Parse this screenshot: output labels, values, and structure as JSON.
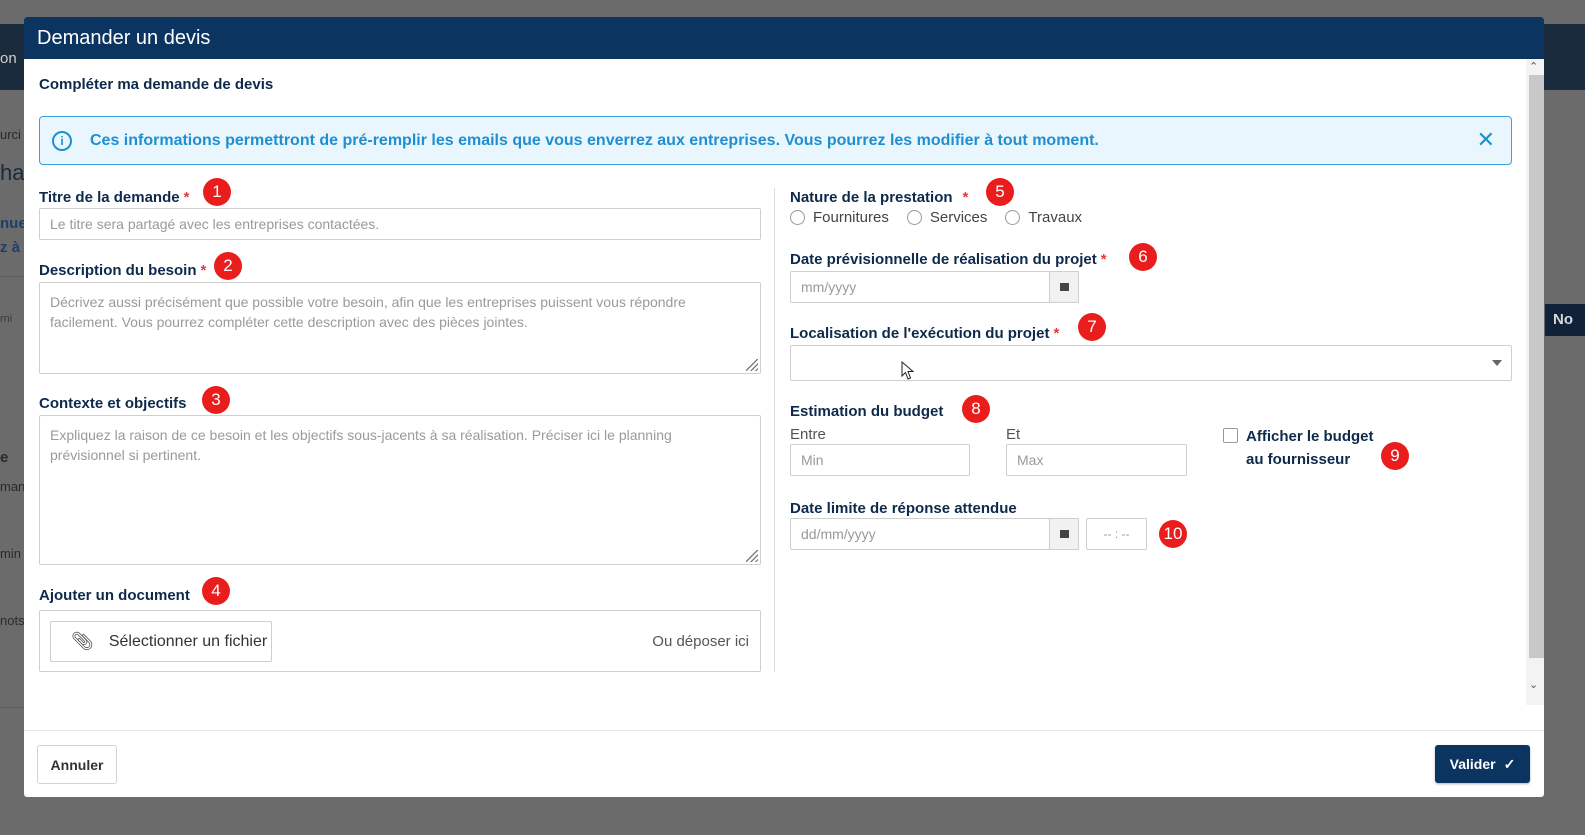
{
  "background": {
    "fragments": [
      "on",
      "urci",
      "ha",
      "nue",
      "z à",
      "rni",
      "e",
      "man",
      "min",
      "nots"
    ],
    "no_button": "No"
  },
  "modal": {
    "title": "Demander un devis",
    "section_title": "Compléter ma demande de devis",
    "alert": {
      "icon": "info-icon",
      "text": "Ces informations permettront de pré-remplir les emails que vous enverrez aux entreprises. Vous pourrez les modifier à tout moment.",
      "close_icon": "close-icon"
    },
    "fields": {
      "titre": {
        "label": "Titre de la demande",
        "required": "*",
        "badge": "1",
        "placeholder": "Le titre sera partagé avec les entreprises contactées."
      },
      "description": {
        "label": "Description du besoin",
        "required": "*",
        "badge": "2",
        "placeholder": "Décrivez aussi précisément que possible votre besoin, afin que les entreprises puissent vous répondre facilement. Vous pourrez compléter cette description avec des pièces jointes."
      },
      "contexte": {
        "label": "Contexte et objectifs",
        "badge": "3",
        "placeholder": "Expliquez la raison de ce besoin et les objectifs sous-jacents à sa réalisation. Préciser ici le planning prévisionnel si pertinent."
      },
      "document": {
        "label": "Ajouter un document",
        "badge": "4",
        "button": "Sélectionner un fichier",
        "drop_text": "Ou déposer ici",
        "icon": "paperclip-icon"
      },
      "nature": {
        "label": "Nature de la prestation",
        "required": "*",
        "badge": "5",
        "options": [
          "Fournitures",
          "Services",
          "Travaux"
        ]
      },
      "date_prev": {
        "label": "Date prévisionnelle de réalisation du projet",
        "required": "*",
        "badge": "6",
        "placeholder": "mm/yyyy",
        "icon": "calendar-icon"
      },
      "localisation": {
        "label": "Localisation de l'exécution du projet",
        "required": "*",
        "badge": "7",
        "value": ""
      },
      "budget": {
        "label": "Estimation du budget",
        "badge": "8",
        "entre": "Entre",
        "et": "Et",
        "min_placeholder": "Min",
        "max_placeholder": "Max"
      },
      "afficher": {
        "label_line1": "Afficher le budget",
        "label_line2": "au fournisseur",
        "badge": "9",
        "checked": false
      },
      "date_limite": {
        "label": "Date limite de réponse attendue",
        "badge": "10",
        "date_placeholder": "dd/mm/yyyy",
        "time_placeholder": "-- : --",
        "icon": "calendar-icon"
      }
    },
    "footer": {
      "cancel": "Annuler",
      "submit": "Valider",
      "submit_icon": "check-icon"
    }
  }
}
